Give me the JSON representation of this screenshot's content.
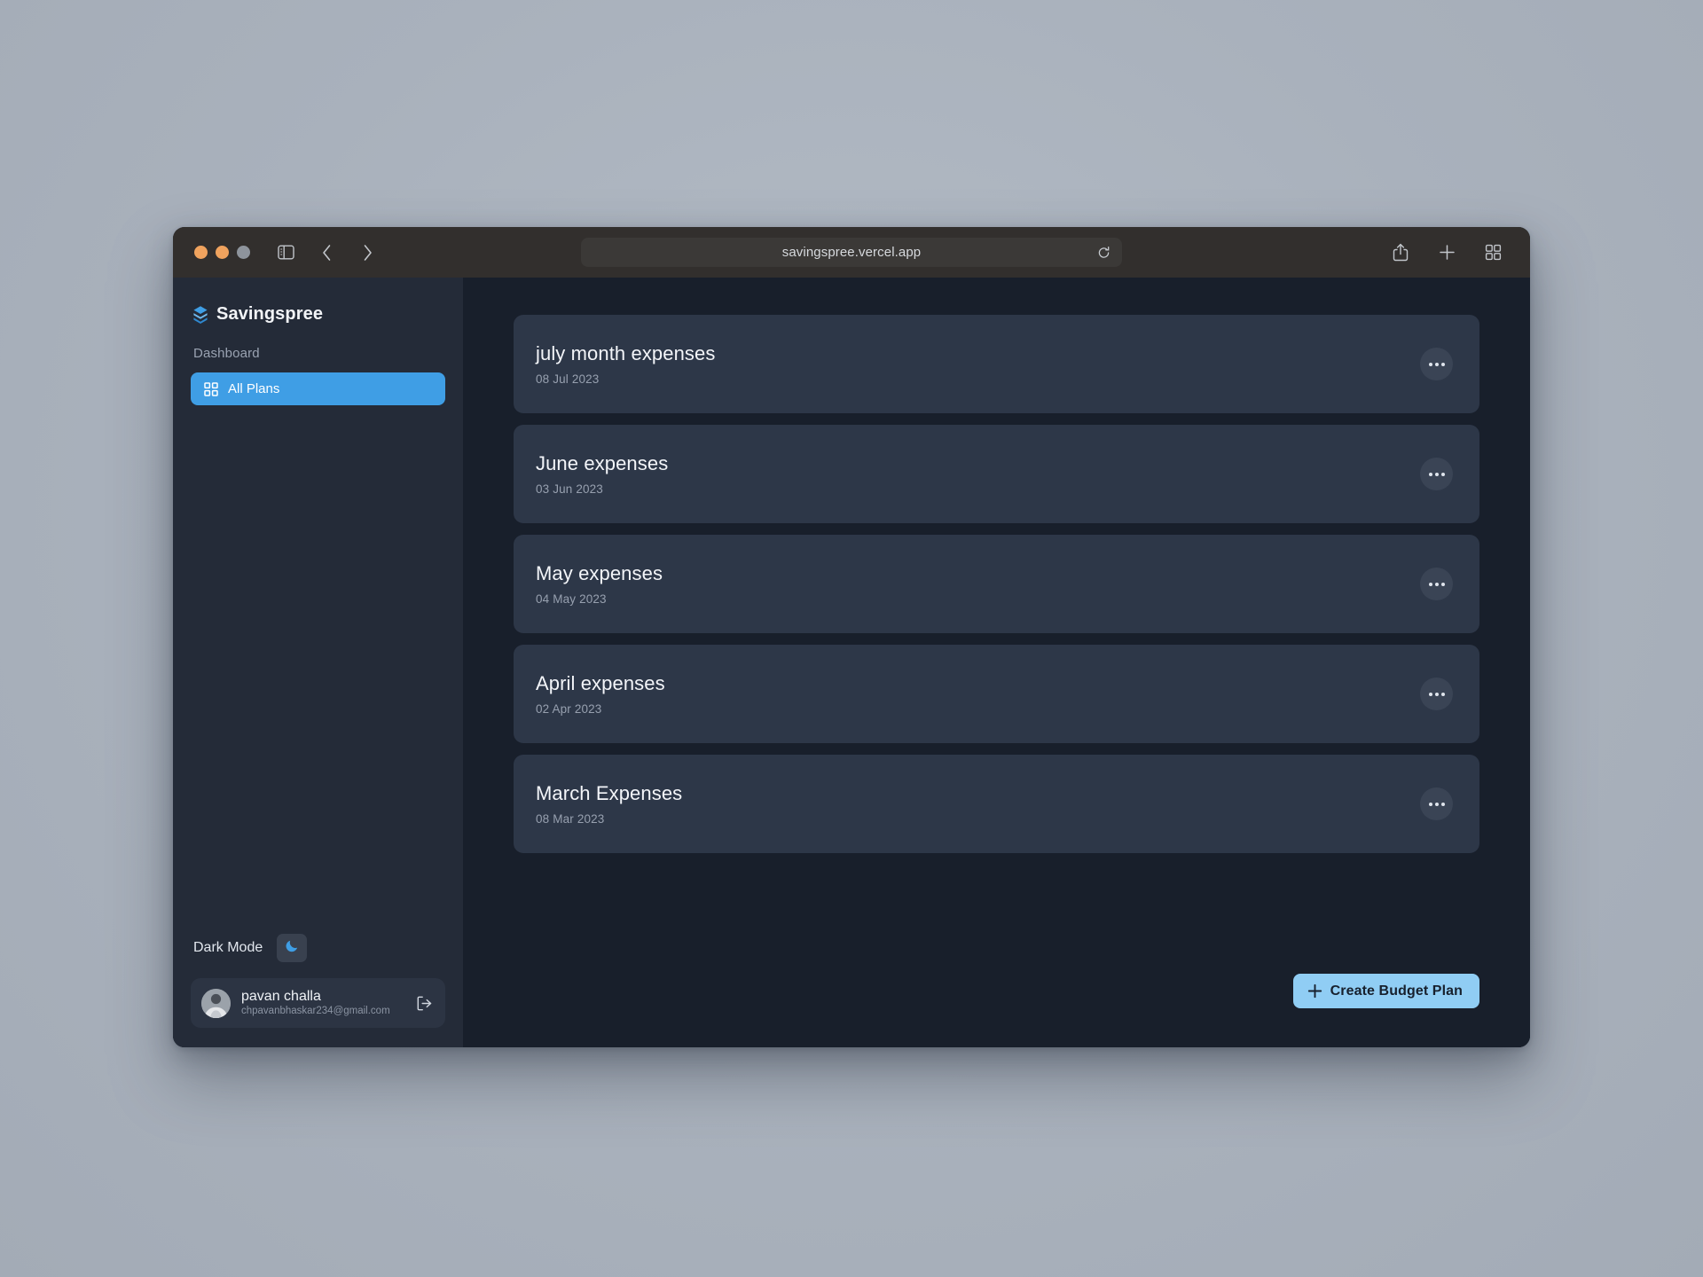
{
  "browser": {
    "url": "savingspree.vercel.app",
    "traffic_lights": [
      "close",
      "minimize",
      "maximize"
    ],
    "nav": {
      "sidebar_toggle_icon": "sidebar-toggle-icon",
      "back_icon": "chevron-left-icon",
      "forward_icon": "chevron-right-icon",
      "reload_icon": "reload-icon"
    },
    "toolbar_right": {
      "share_icon": "share-icon",
      "new_tab_icon": "plus-icon",
      "tab_overview_icon": "tab-grid-icon"
    }
  },
  "sidebar": {
    "brand": {
      "name": "Savingspree",
      "logo_icon": "layers-logo-icon",
      "logo_color": "#3f9ee5"
    },
    "section_label": "Dashboard",
    "nav_items": [
      {
        "label": "All Plans",
        "icon": "grid-icon",
        "active": true
      }
    ],
    "dark_mode": {
      "label": "Dark Mode",
      "toggle_icon": "moon-icon",
      "toggle_icon_color": "#3f9ee5"
    },
    "user": {
      "name": "pavan challa",
      "email": "chpavanbhaskar234@gmail.com",
      "avatar_icon": "avatar",
      "logout_icon": "logout-icon"
    }
  },
  "main": {
    "plans": [
      {
        "title": "july month expenses",
        "date": "08 Jul 2023",
        "menu_icon": "ellipsis-icon"
      },
      {
        "title": "June expenses",
        "date": "03 Jun 2023",
        "menu_icon": "ellipsis-icon"
      },
      {
        "title": "May expenses",
        "date": "04 May 2023",
        "menu_icon": "ellipsis-icon"
      },
      {
        "title": "April expenses",
        "date": "02 Apr 2023",
        "menu_icon": "ellipsis-icon"
      },
      {
        "title": "March Expenses",
        "date": "08 Mar 2023",
        "menu_icon": "ellipsis-icon"
      }
    ],
    "create_button": {
      "label": "Create Budget Plan",
      "icon": "plus-icon",
      "background": "#90cdf4",
      "text_color": "#17202d"
    }
  },
  "theme": {
    "desktop_background": "#aeb6c0",
    "titlebar": "#322f2d",
    "sidebar_background": "#242b38",
    "main_background": "#181f2b",
    "card_background": "#2d3748",
    "accent_blue": "#3f9ee5",
    "accent_light_blue": "#90cdf4"
  }
}
